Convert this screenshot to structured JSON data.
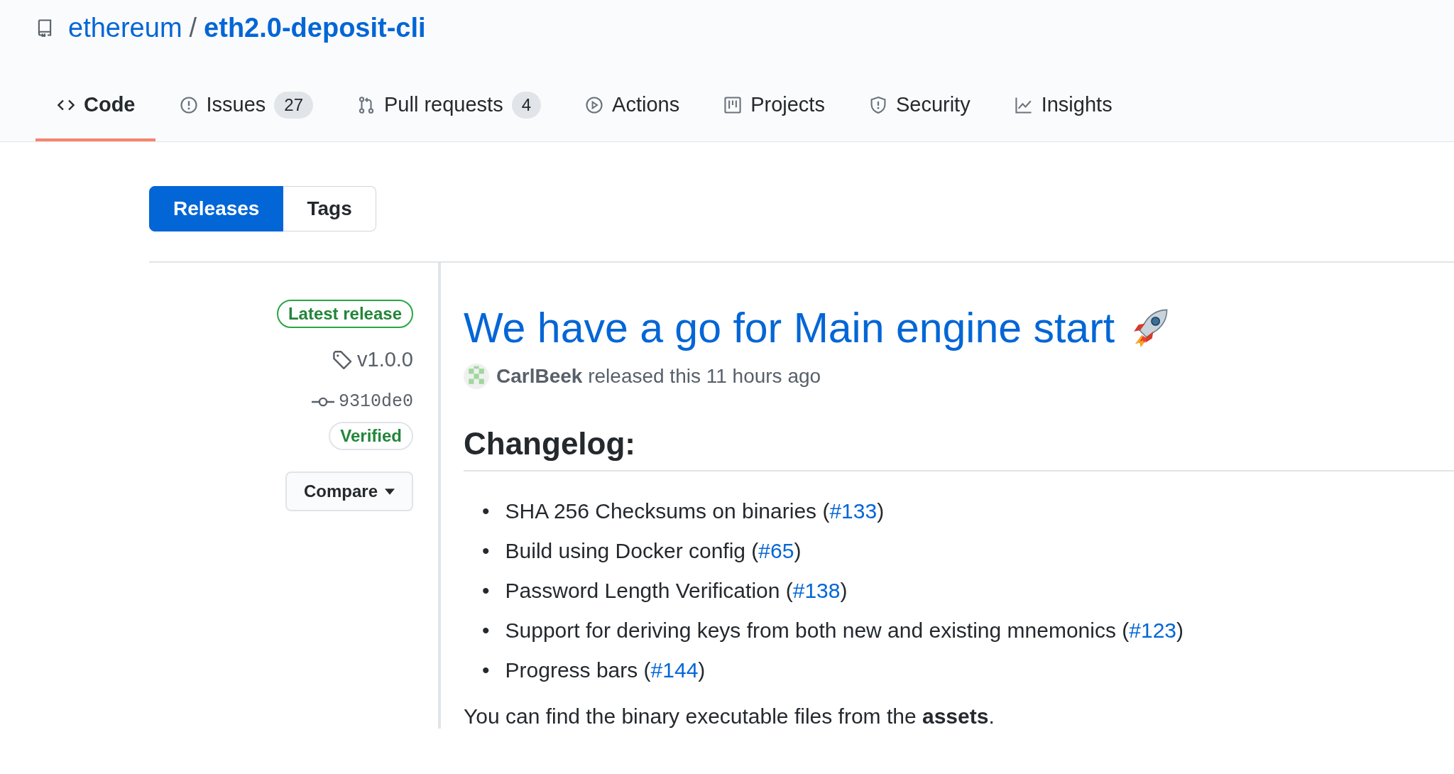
{
  "repo": {
    "owner": "ethereum",
    "separator": "/",
    "name": "eth2.0-deposit-cli"
  },
  "tabs": [
    {
      "label": "Code",
      "selected": true
    },
    {
      "label": "Issues",
      "count": "27",
      "selected": false
    },
    {
      "label": "Pull requests",
      "count": "4",
      "selected": false
    },
    {
      "label": "Actions",
      "selected": false
    },
    {
      "label": "Projects",
      "selected": false
    },
    {
      "label": "Security",
      "selected": false
    },
    {
      "label": "Insights",
      "selected": false
    }
  ],
  "subnav": [
    {
      "label": "Releases",
      "selected": true
    },
    {
      "label": "Tags",
      "selected": false
    }
  ],
  "release": {
    "badge": "Latest release",
    "tag": "v1.0.0",
    "commit": "9310de0",
    "verified": "Verified",
    "compare": "Compare",
    "title": "We have a go for Main engine start",
    "author": "CarlBeek",
    "meta": "released this 11 hours ago",
    "heading": "Changelog:",
    "items": [
      {
        "marker": "•",
        "text": "SHA 256 Checksums on binaries (",
        "link": "#133",
        "after": ")"
      },
      {
        "marker": "•",
        "text": "Build using Docker config (",
        "link": "#65",
        "after": ")"
      },
      {
        "marker": "•",
        "text": "Password Length Verification (",
        "link": "#138",
        "after": ")"
      },
      {
        "marker": "•",
        "text": "Support for deriving keys from both new and existing mnemonics (",
        "link": "#123",
        "after": ")"
      },
      {
        "marker": "•",
        "text": "Progress bars (",
        "link": "#144",
        "after": ")"
      }
    ],
    "footer": "You can find the binary executable files from the **assets**."
  }
}
